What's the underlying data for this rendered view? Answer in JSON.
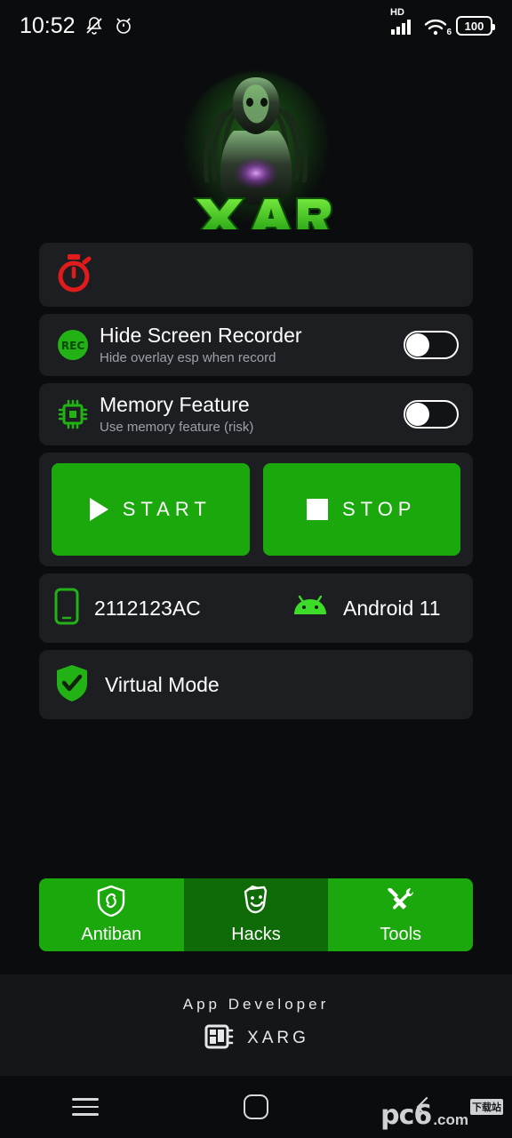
{
  "statusbar": {
    "time": "10:52",
    "icons_left": [
      "bell-mute-icon",
      "alarm-clock-icon"
    ],
    "network_label": "HD",
    "wifi_label": "6",
    "battery_level": "100"
  },
  "logo": {
    "name": "xarg-logo",
    "wordmark": "XARG",
    "accent_color": "#3ddc28"
  },
  "cards": {
    "timer": {
      "icon": "stopwatch-icon",
      "icon_color": "#e01b1b"
    },
    "hide_recorder": {
      "icon": "rec-icon",
      "title": "Hide Screen Recorder",
      "subtitle": "Hide overlay esp when record",
      "toggle_state": "off"
    },
    "memory_feature": {
      "icon": "cpu-chip-icon",
      "title": "Memory Feature",
      "subtitle": "Use memory feature (risk)",
      "toggle_state": "off"
    },
    "actions": {
      "start_label": "START",
      "stop_label": "STOP",
      "button_color": "#1aa80c"
    },
    "device": {
      "phone_icon": "smartphone-icon",
      "device_model": "2112123AC",
      "android_icon": "android-icon",
      "os_version": "Android 11"
    },
    "virtual_mode": {
      "icon": "shield-check-icon",
      "label": "Virtual Mode"
    }
  },
  "bottom_nav": {
    "items": [
      {
        "label": "Antiban",
        "icon": "shield-link-icon",
        "active": false
      },
      {
        "label": "Hacks",
        "icon": "theater-mask-icon",
        "active": true
      },
      {
        "label": "Tools",
        "icon": "tools-icon",
        "active": false
      }
    ]
  },
  "footer": {
    "title": "App Developer",
    "icon": "chip-dashboard-icon",
    "developer": "XARG"
  },
  "android_nav": {
    "recents": "menu-icon",
    "home": "home-icon",
    "back": "back-icon"
  },
  "watermark": {
    "main": "pc6",
    "domain": ".com",
    "badge": "下载站"
  }
}
